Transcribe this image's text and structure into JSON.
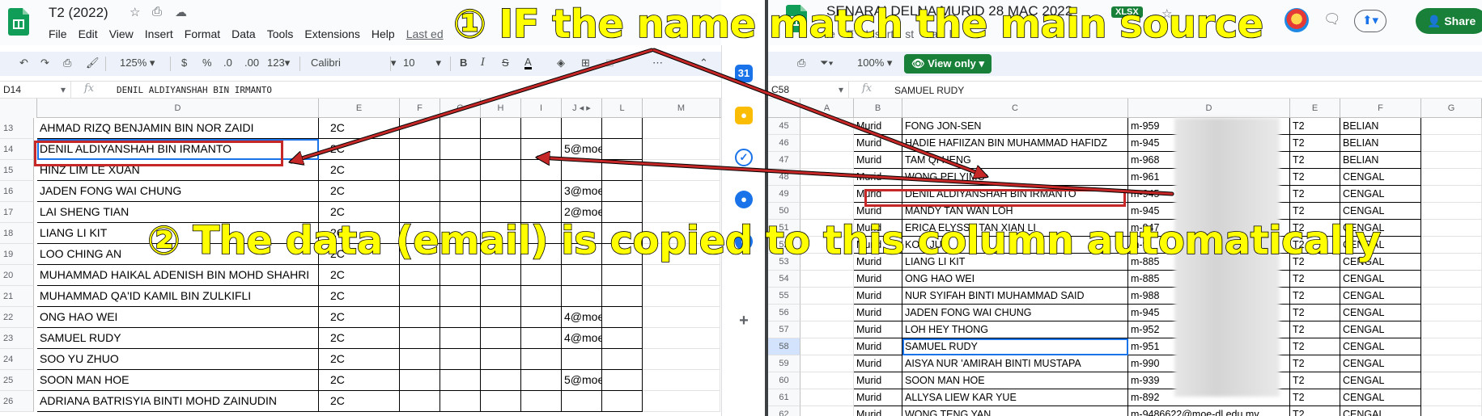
{
  "left_sheet": {
    "title": "T2 (2022)",
    "menu": [
      "File",
      "Edit",
      "View",
      "Insert",
      "Format",
      "Data",
      "Tools",
      "Extensions",
      "Help"
    ],
    "last_edit": "Last ed",
    "toolbar": {
      "zoom": "125%",
      "currency": "$",
      "percent": "%",
      "dec_less": ".0",
      "dec_more": ".00",
      "format": "123",
      "font": "Calibri",
      "size": "10"
    },
    "cell_ref": "D14",
    "formula": "DENIL ALDIYANSHAH BIN IRMANTO",
    "columns": [
      "D",
      "E",
      "F",
      "G",
      "H",
      "I",
      "J",
      "L",
      "M"
    ],
    "rows": [
      {
        "n": "13",
        "name": "AHMAD RIZQ BENJAMIN BIN NOR ZAIDI",
        "class": "2C",
        "email": ""
      },
      {
        "n": "14",
        "name": "DENIL ALDIYANSHAH BIN IRMANTO",
        "class": "2C",
        "email": "5@moe"
      },
      {
        "n": "15",
        "name": "HINZ LIM LE XUAN",
        "class": "2C",
        "email": ""
      },
      {
        "n": "16",
        "name": "JADEN FONG WAI CHUNG",
        "class": "2C",
        "email": "3@moe"
      },
      {
        "n": "17",
        "name": "LAI SHENG TIAN",
        "class": "2C",
        "email": "2@moe"
      },
      {
        "n": "18",
        "name": "LIANG LI KIT",
        "class": "2C",
        "email": ""
      },
      {
        "n": "19",
        "name": "LOO CHING AN",
        "class": "2C",
        "email": ""
      },
      {
        "n": "20",
        "name": "MUHAMMAD HAIKAL ADENISH BIN MOHD SHAHRI",
        "class": "2C",
        "email": ""
      },
      {
        "n": "21",
        "name": "MUHAMMAD QA'ID KAMIL BIN ZULKIFLI",
        "class": "2C",
        "email": ""
      },
      {
        "n": "22",
        "name": "ONG HAO WEI",
        "class": "2C",
        "email": "4@moe"
      },
      {
        "n": "23",
        "name": "SAMUEL RUDY",
        "class": "2C",
        "email": "4@moe"
      },
      {
        "n": "24",
        "name": "SOO YU ZHUO",
        "class": "2C",
        "email": ""
      },
      {
        "n": "25",
        "name": "SOON MAN HOE",
        "class": "2C",
        "email": "5@moe"
      },
      {
        "n": "26",
        "name": "ADRIANA BATRISYIA BINTI MOHD ZAINUDIN",
        "class": "2C",
        "email": ""
      }
    ]
  },
  "right_sheet": {
    "title": "SENARAI NAMA MURID 28 MAC 2022",
    "title_visible": "SENARAI DELNA MURID 28 MAC 2022",
    "badge": "XLSX",
    "share": "Share",
    "menu_fragment": [
      "le",
      "E",
      "Insert",
      "st",
      "aa",
      "l"
    ],
    "zoom": "100%",
    "view_only": "View only",
    "cell_ref": "C58",
    "formula": "SAMUEL RUDY",
    "columns": [
      "A",
      "B",
      "C",
      "D",
      "E",
      "F",
      "G"
    ],
    "rows": [
      {
        "n": "45",
        "b": "Murid",
        "c": "FONG JON-SEN",
        "d": "m-959",
        "e": "T2",
        "f": "BELIAN"
      },
      {
        "n": "46",
        "b": "Murid",
        "c": "HADIE HAFIIZAN BIN MUHAMMAD HAFIDZ",
        "d": "m-945",
        "e": "T2",
        "f": "BELIAN"
      },
      {
        "n": "47",
        "b": "Murid",
        "c": "TAM QI HENG",
        "d": "m-968",
        "e": "T2",
        "f": "BELIAN"
      },
      {
        "n": "48",
        "b": "Murid",
        "c": "WONG PEI YIMO",
        "d": "m-961",
        "e": "T2",
        "f": "CENGAL"
      },
      {
        "n": "49",
        "b": "Murid",
        "c": "DENIL ALDIYANSHAH BIN IRMANTO",
        "d": "m-945",
        "e": "T2",
        "f": "CENGAL"
      },
      {
        "n": "50",
        "b": "Murid",
        "c": "MANDY TAN WAN LOH",
        "d": "m-945",
        "e": "T2",
        "f": "CENGAL"
      },
      {
        "n": "51",
        "b": "Murid",
        "c": "ERICA ELYSSA TAN XIAN LI",
        "d": "m-947",
        "e": "T2",
        "f": "CENGAL"
      },
      {
        "n": "52",
        "b": "Murid",
        "c": "KOH JUN",
        "d": "m-9",
        "e": "T2",
        "f": "CENGAL"
      },
      {
        "n": "53",
        "b": "Murid",
        "c": "LIANG LI KIT",
        "d": "m-885",
        "e": "T2",
        "f": "CENGAL"
      },
      {
        "n": "54",
        "b": "Murid",
        "c": "ONG HAO WEI",
        "d": "m-885",
        "e": "T2",
        "f": "CENGAL"
      },
      {
        "n": "55",
        "b": "Murid",
        "c": "NUR SYIFAH BINTI MUHAMMAD SAID",
        "d": "m-988",
        "e": "T2",
        "f": "CENGAL"
      },
      {
        "n": "56",
        "b": "Murid",
        "c": "JADEN FONG WAI CHUNG",
        "d": "m-945",
        "e": "T2",
        "f": "CENGAL"
      },
      {
        "n": "57",
        "b": "Murid",
        "c": "LOH HEY THONG",
        "d": "m-952",
        "e": "T2",
        "f": "CENGAL"
      },
      {
        "n": "58",
        "b": "Murid",
        "c": "SAMUEL RUDY",
        "d": "m-951",
        "e": "T2",
        "f": "CENGAL"
      },
      {
        "n": "59",
        "b": "Murid",
        "c": "AISYA NUR 'AMIRAH BINTI MUSTAPA",
        "d": "m-990",
        "e": "T2",
        "f": "CENGAL"
      },
      {
        "n": "60",
        "b": "Murid",
        "c": "SOON MAN HOE",
        "d": "m-939",
        "e": "T2",
        "f": "CENGAL"
      },
      {
        "n": "61",
        "b": "Murid",
        "c": "ALLYSA LIEW KAR YUE",
        "d": "m-892",
        "e": "T2",
        "f": "CENGAL"
      },
      {
        "n": "62",
        "b": "Murid",
        "c": "WONG TENG YAN",
        "d": "m-9486622@moe-dl.edu.my",
        "e": "T2",
        "f": "CENGAL"
      }
    ]
  },
  "annotations": {
    "step1": "① IF the name match the main source",
    "step2": "② The data (email) is copied to this column automatically"
  },
  "colors": {
    "sheets_green": "#188038",
    "highlight_red": "#c62828",
    "annot_yellow": "#ffff00"
  },
  "icons": [
    "undo-icon",
    "redo-icon",
    "print-icon",
    "paint-format-icon",
    "bold-icon",
    "italic-icon",
    "strikethrough-icon",
    "text-color-icon",
    "fill-color-icon",
    "borders-icon",
    "star-icon",
    "move-icon",
    "cloud-icon",
    "comment-icon",
    "present-icon",
    "filter-icon",
    "calendar-icon",
    "keep-icon",
    "tasks-icon",
    "contacts-icon",
    "plus-icon"
  ]
}
